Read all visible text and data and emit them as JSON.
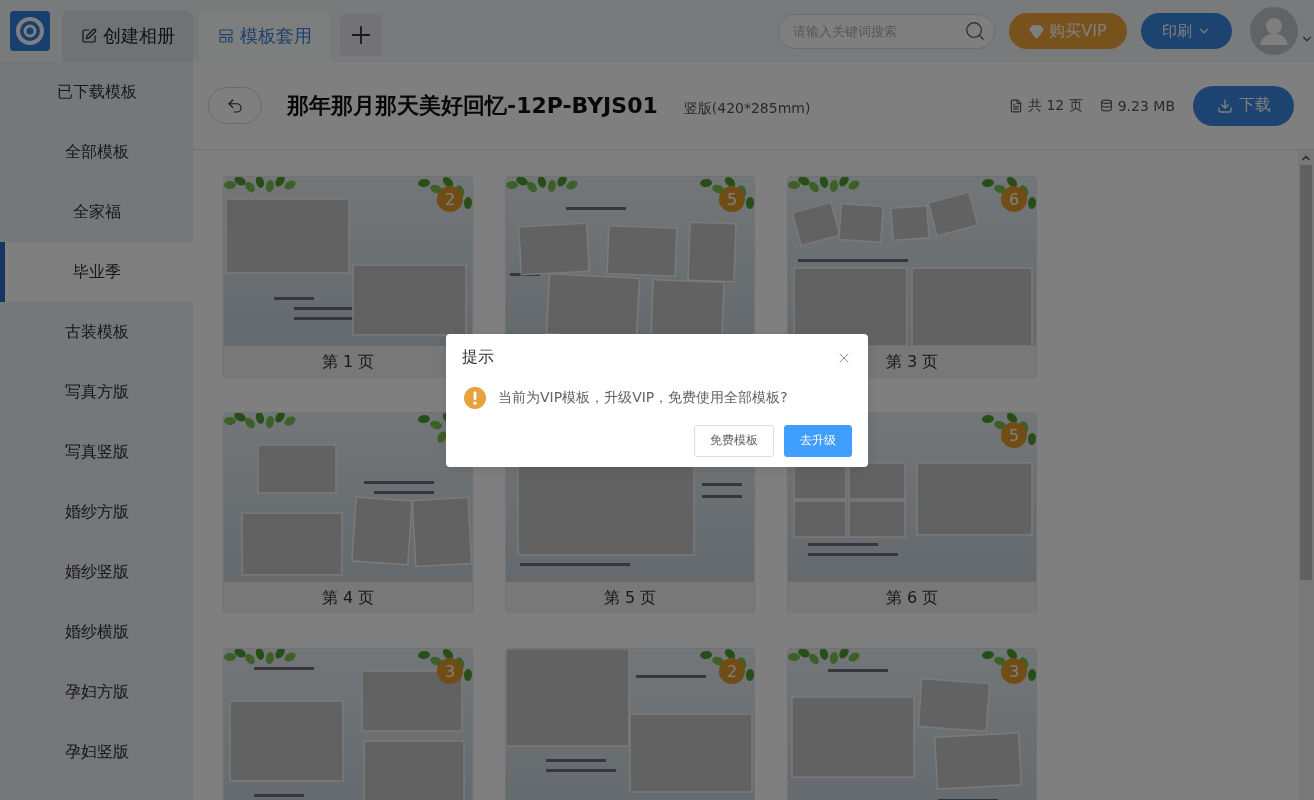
{
  "app_bar": {
    "tabs": [
      {
        "label": "创建相册",
        "selected": false
      },
      {
        "label": "模板套用",
        "selected": true
      }
    ],
    "search": {
      "placeholder": "请输入关键词搜索"
    },
    "vip_button": "购买VIP",
    "print_menu": "印刷"
  },
  "sidebar": {
    "items": [
      {
        "label": "已下载模板",
        "selected": false
      },
      {
        "label": "全部模板",
        "selected": false
      },
      {
        "label": "全家福",
        "selected": false
      },
      {
        "label": "毕业季",
        "selected": true
      },
      {
        "label": "古装模板",
        "selected": false
      },
      {
        "label": "写真方版",
        "selected": false
      },
      {
        "label": "写真竖版",
        "selected": false
      },
      {
        "label": "婚纱方版",
        "selected": false
      },
      {
        "label": "婚纱竖版",
        "selected": false
      },
      {
        "label": "婚纱横版",
        "selected": false
      },
      {
        "label": "孕妇方版",
        "selected": false
      },
      {
        "label": "孕妇竖版",
        "selected": false
      }
    ]
  },
  "template": {
    "title": "那年那月那天美好回忆-12P-BYJS01",
    "format": "竖版(420*285mm)",
    "page_count": "共 12 页",
    "file_size": "9.23 MB",
    "download_button": "下载"
  },
  "pages": [
    {
      "label": "第 1 页",
      "badge": "2"
    },
    {
      "badge": "5"
    },
    {
      "label": "第 3 页",
      "badge": "6"
    },
    {
      "label": "第 4 页"
    },
    {
      "label": "第 5 页"
    },
    {
      "label": "第 6 页",
      "badge": "5"
    },
    {
      "badge": "3"
    },
    {
      "badge": "2"
    },
    {
      "badge": "3"
    }
  ],
  "dialog": {
    "title": "提示",
    "message": "当前为VIP模板，升级VIP，免费使用全部模板?",
    "buttons": [
      {
        "label": "免费模板",
        "kind": "secondary"
      },
      {
        "label": "去升级",
        "kind": "primary"
      }
    ]
  }
}
